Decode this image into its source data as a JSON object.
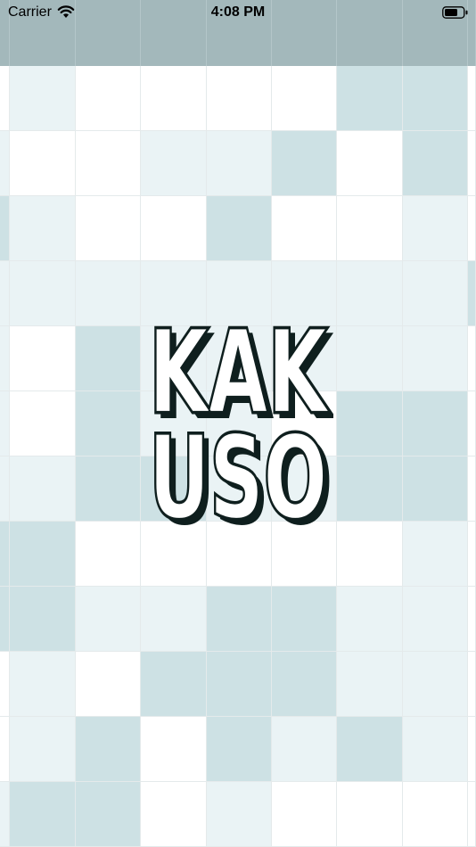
{
  "status_bar": {
    "carrier": "Carrier",
    "time": "4:08 PM",
    "icons": [
      "wifi-icon",
      "battery-icon"
    ]
  },
  "logo": {
    "line1": "KAK",
    "line2": "USO",
    "ink_color": "#0f1f1e"
  },
  "board": {
    "palette": {
      "white": "#ffffff",
      "light": "#eaf3f5",
      "mid": "#cde1e4"
    },
    "rows": [
      "wlwwwwmmw",
      "lwwllmwmw",
      "mlwwmwwlw",
      "llllllllm",
      "lwmlllllw",
      "lwmllwmmw",
      "llmmllmmw",
      "mmwwwwwlw",
      "mmllmmllw",
      "wlwmmmllw",
      "wlmwmlmlw",
      "lmmwlwwww"
    ]
  }
}
